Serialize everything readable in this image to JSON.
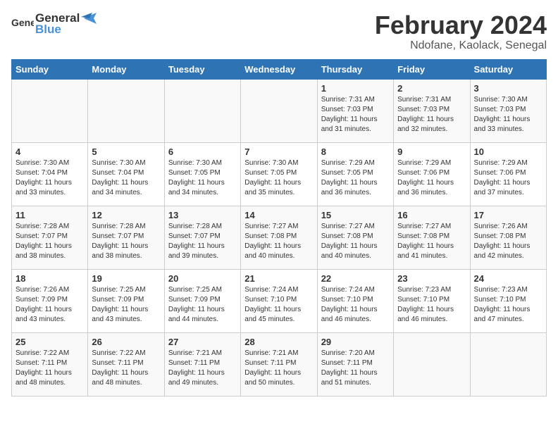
{
  "header": {
    "logo_general": "General",
    "logo_blue": "Blue",
    "month": "February 2024",
    "location": "Ndofane, Kaolack, Senegal"
  },
  "days_of_week": [
    "Sunday",
    "Monday",
    "Tuesday",
    "Wednesday",
    "Thursday",
    "Friday",
    "Saturday"
  ],
  "weeks": [
    [
      {
        "day": "",
        "info": ""
      },
      {
        "day": "",
        "info": ""
      },
      {
        "day": "",
        "info": ""
      },
      {
        "day": "",
        "info": ""
      },
      {
        "day": "1",
        "info": "Sunrise: 7:31 AM\nSunset: 7:03 PM\nDaylight: 11 hours\nand 31 minutes."
      },
      {
        "day": "2",
        "info": "Sunrise: 7:31 AM\nSunset: 7:03 PM\nDaylight: 11 hours\nand 32 minutes."
      },
      {
        "day": "3",
        "info": "Sunrise: 7:30 AM\nSunset: 7:03 PM\nDaylight: 11 hours\nand 33 minutes."
      }
    ],
    [
      {
        "day": "4",
        "info": "Sunrise: 7:30 AM\nSunset: 7:04 PM\nDaylight: 11 hours\nand 33 minutes."
      },
      {
        "day": "5",
        "info": "Sunrise: 7:30 AM\nSunset: 7:04 PM\nDaylight: 11 hours\nand 34 minutes."
      },
      {
        "day": "6",
        "info": "Sunrise: 7:30 AM\nSunset: 7:05 PM\nDaylight: 11 hours\nand 34 minutes."
      },
      {
        "day": "7",
        "info": "Sunrise: 7:30 AM\nSunset: 7:05 PM\nDaylight: 11 hours\nand 35 minutes."
      },
      {
        "day": "8",
        "info": "Sunrise: 7:29 AM\nSunset: 7:05 PM\nDaylight: 11 hours\nand 36 minutes."
      },
      {
        "day": "9",
        "info": "Sunrise: 7:29 AM\nSunset: 7:06 PM\nDaylight: 11 hours\nand 36 minutes."
      },
      {
        "day": "10",
        "info": "Sunrise: 7:29 AM\nSunset: 7:06 PM\nDaylight: 11 hours\nand 37 minutes."
      }
    ],
    [
      {
        "day": "11",
        "info": "Sunrise: 7:28 AM\nSunset: 7:07 PM\nDaylight: 11 hours\nand 38 minutes."
      },
      {
        "day": "12",
        "info": "Sunrise: 7:28 AM\nSunset: 7:07 PM\nDaylight: 11 hours\nand 38 minutes."
      },
      {
        "day": "13",
        "info": "Sunrise: 7:28 AM\nSunset: 7:07 PM\nDaylight: 11 hours\nand 39 minutes."
      },
      {
        "day": "14",
        "info": "Sunrise: 7:27 AM\nSunset: 7:08 PM\nDaylight: 11 hours\nand 40 minutes."
      },
      {
        "day": "15",
        "info": "Sunrise: 7:27 AM\nSunset: 7:08 PM\nDaylight: 11 hours\nand 40 minutes."
      },
      {
        "day": "16",
        "info": "Sunrise: 7:27 AM\nSunset: 7:08 PM\nDaylight: 11 hours\nand 41 minutes."
      },
      {
        "day": "17",
        "info": "Sunrise: 7:26 AM\nSunset: 7:08 PM\nDaylight: 11 hours\nand 42 minutes."
      }
    ],
    [
      {
        "day": "18",
        "info": "Sunrise: 7:26 AM\nSunset: 7:09 PM\nDaylight: 11 hours\nand 43 minutes."
      },
      {
        "day": "19",
        "info": "Sunrise: 7:25 AM\nSunset: 7:09 PM\nDaylight: 11 hours\nand 43 minutes."
      },
      {
        "day": "20",
        "info": "Sunrise: 7:25 AM\nSunset: 7:09 PM\nDaylight: 11 hours\nand 44 minutes."
      },
      {
        "day": "21",
        "info": "Sunrise: 7:24 AM\nSunset: 7:10 PM\nDaylight: 11 hours\nand 45 minutes."
      },
      {
        "day": "22",
        "info": "Sunrise: 7:24 AM\nSunset: 7:10 PM\nDaylight: 11 hours\nand 46 minutes."
      },
      {
        "day": "23",
        "info": "Sunrise: 7:23 AM\nSunset: 7:10 PM\nDaylight: 11 hours\nand 46 minutes."
      },
      {
        "day": "24",
        "info": "Sunrise: 7:23 AM\nSunset: 7:10 PM\nDaylight: 11 hours\nand 47 minutes."
      }
    ],
    [
      {
        "day": "25",
        "info": "Sunrise: 7:22 AM\nSunset: 7:11 PM\nDaylight: 11 hours\nand 48 minutes."
      },
      {
        "day": "26",
        "info": "Sunrise: 7:22 AM\nSunset: 7:11 PM\nDaylight: 11 hours\nand 48 minutes."
      },
      {
        "day": "27",
        "info": "Sunrise: 7:21 AM\nSunset: 7:11 PM\nDaylight: 11 hours\nand 49 minutes."
      },
      {
        "day": "28",
        "info": "Sunrise: 7:21 AM\nSunset: 7:11 PM\nDaylight: 11 hours\nand 50 minutes."
      },
      {
        "day": "29",
        "info": "Sunrise: 7:20 AM\nSunset: 7:11 PM\nDaylight: 11 hours\nand 51 minutes."
      },
      {
        "day": "",
        "info": ""
      },
      {
        "day": "",
        "info": ""
      }
    ]
  ]
}
